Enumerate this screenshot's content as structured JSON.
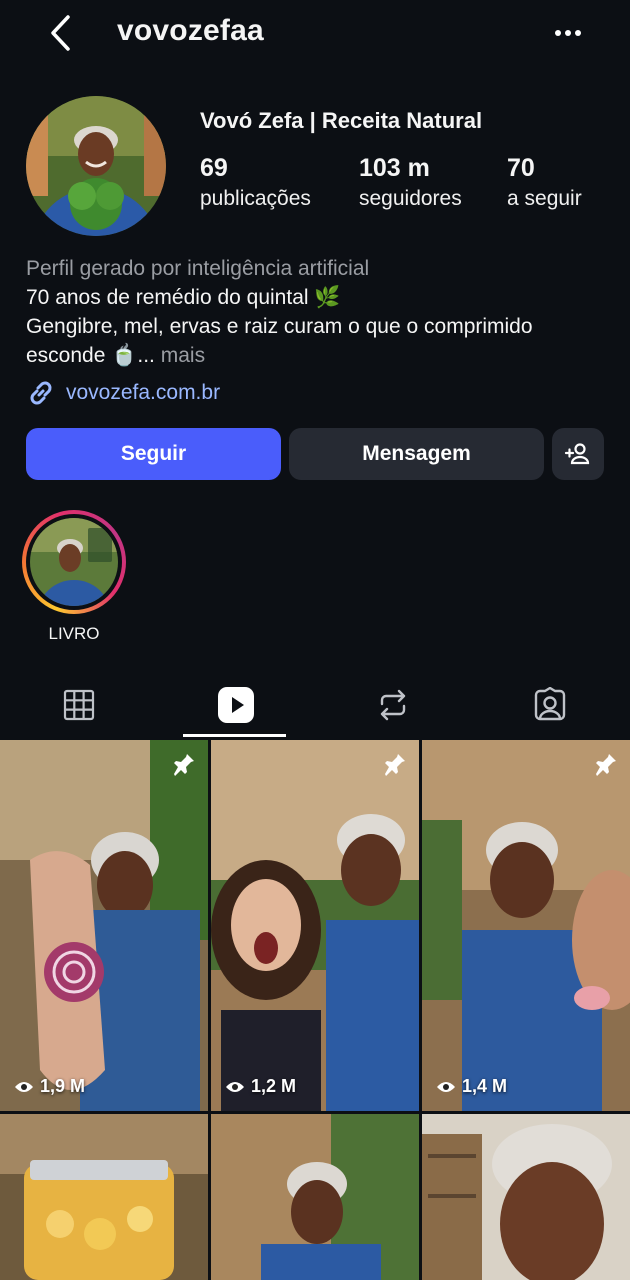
{
  "header": {
    "username": "vovozefaa",
    "back_icon": "chevron-left-icon",
    "more_icon": "more-horizontal-icon"
  },
  "profile": {
    "display_name": "Vovó Zefa | Receita Natural",
    "stats": [
      {
        "value": "69",
        "label": "publicações"
      },
      {
        "value": "103 m",
        "label": "seguidores"
      },
      {
        "value": "70",
        "label": "a seguir"
      }
    ],
    "ai_notice": "Perfil gerado por inteligência artificial",
    "bio_lines": [
      "70 anos de remédio do quintal 🌿",
      "Gengibre, mel, ervas e raiz curam o que o comprimido",
      "esconde 🍵..."
    ],
    "bio_more": "mais",
    "link": "vovozefa.com.br"
  },
  "actions": {
    "follow": "Seguir",
    "message": "Mensagem",
    "add_user_icon": "person-add-icon"
  },
  "highlights": [
    {
      "label": "LIVRO"
    }
  ],
  "tabs": [
    {
      "name": "grid",
      "icon": "grid-icon",
      "active": false
    },
    {
      "name": "reels",
      "icon": "reels-icon",
      "active": true
    },
    {
      "name": "reposts",
      "icon": "repost-icon",
      "active": false
    },
    {
      "name": "tagged",
      "icon": "tagged-icon",
      "active": false
    }
  ],
  "reels": [
    {
      "views": "1,9 M",
      "pinned": true
    },
    {
      "views": "1,2 M",
      "pinned": true
    },
    {
      "views": "1,4 M",
      "pinned": true
    },
    {
      "views": "",
      "pinned": false
    },
    {
      "views": "",
      "pinned": false
    },
    {
      "views": "",
      "pinned": false
    }
  ],
  "colors": {
    "background": "#0c0f14",
    "follow_button": "#4a5dfb",
    "secondary_button": "#262a33",
    "link": "#9ab8ff"
  }
}
